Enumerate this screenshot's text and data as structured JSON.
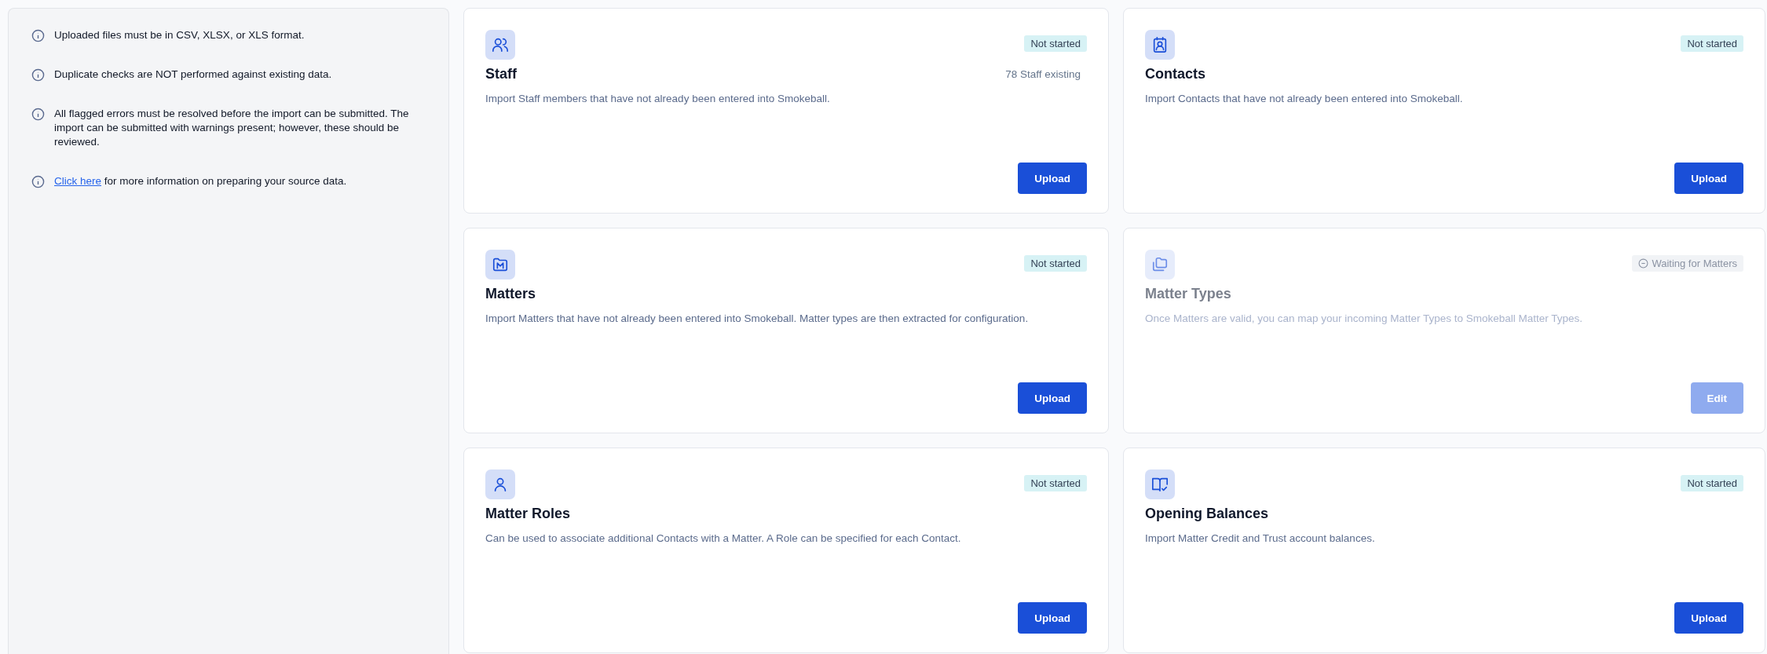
{
  "notes": [
    {
      "text": "Uploaded files must be in CSV, XLSX, or XLS format."
    },
    {
      "text": "Duplicate checks are NOT performed against existing data."
    },
    {
      "text": "All flagged errors must be resolved before the import can be submitted. The import can be submitted with warnings present; however, these should be reviewed."
    },
    {
      "link": "Click here",
      "text": " for more information on preparing your source data."
    }
  ],
  "cards": [
    {
      "title": "Staff",
      "status": {
        "kind": "not_started",
        "label": "Not started"
      },
      "count": "78 Staff existing",
      "description": "Import Staff members that have not already been entered into Smokeball.",
      "button": "Upload",
      "disabled": false
    },
    {
      "title": "Contacts",
      "status": {
        "kind": "not_started",
        "label": "Not started"
      },
      "description": "Import Contacts that have not already been entered into Smokeball.",
      "button": "Upload",
      "disabled": false
    },
    {
      "title": "Matters",
      "status": {
        "kind": "not_started",
        "label": "Not started"
      },
      "description": "Import Matters that have not already been entered into Smokeball. Matter types are then extracted for configuration.",
      "button": "Upload",
      "disabled": false
    },
    {
      "title": "Matter Types",
      "status": {
        "kind": "waiting",
        "label": "Waiting for Matters"
      },
      "description": "Once Matters are valid, you can map your incoming Matter Types to Smokeball Matter Types.",
      "button": "Edit",
      "disabled": true
    },
    {
      "title": "Matter Roles",
      "status": {
        "kind": "not_started",
        "label": "Not started"
      },
      "description": "Can be used to associate additional Contacts with a Matter. A Role can be specified for each Contact.",
      "button": "Upload",
      "disabled": false
    },
    {
      "title": "Opening Balances",
      "status": {
        "kind": "not_started",
        "label": "Not started"
      },
      "description": "Import Matter Credit and Trust account balances.",
      "button": "Upload",
      "disabled": false
    }
  ]
}
